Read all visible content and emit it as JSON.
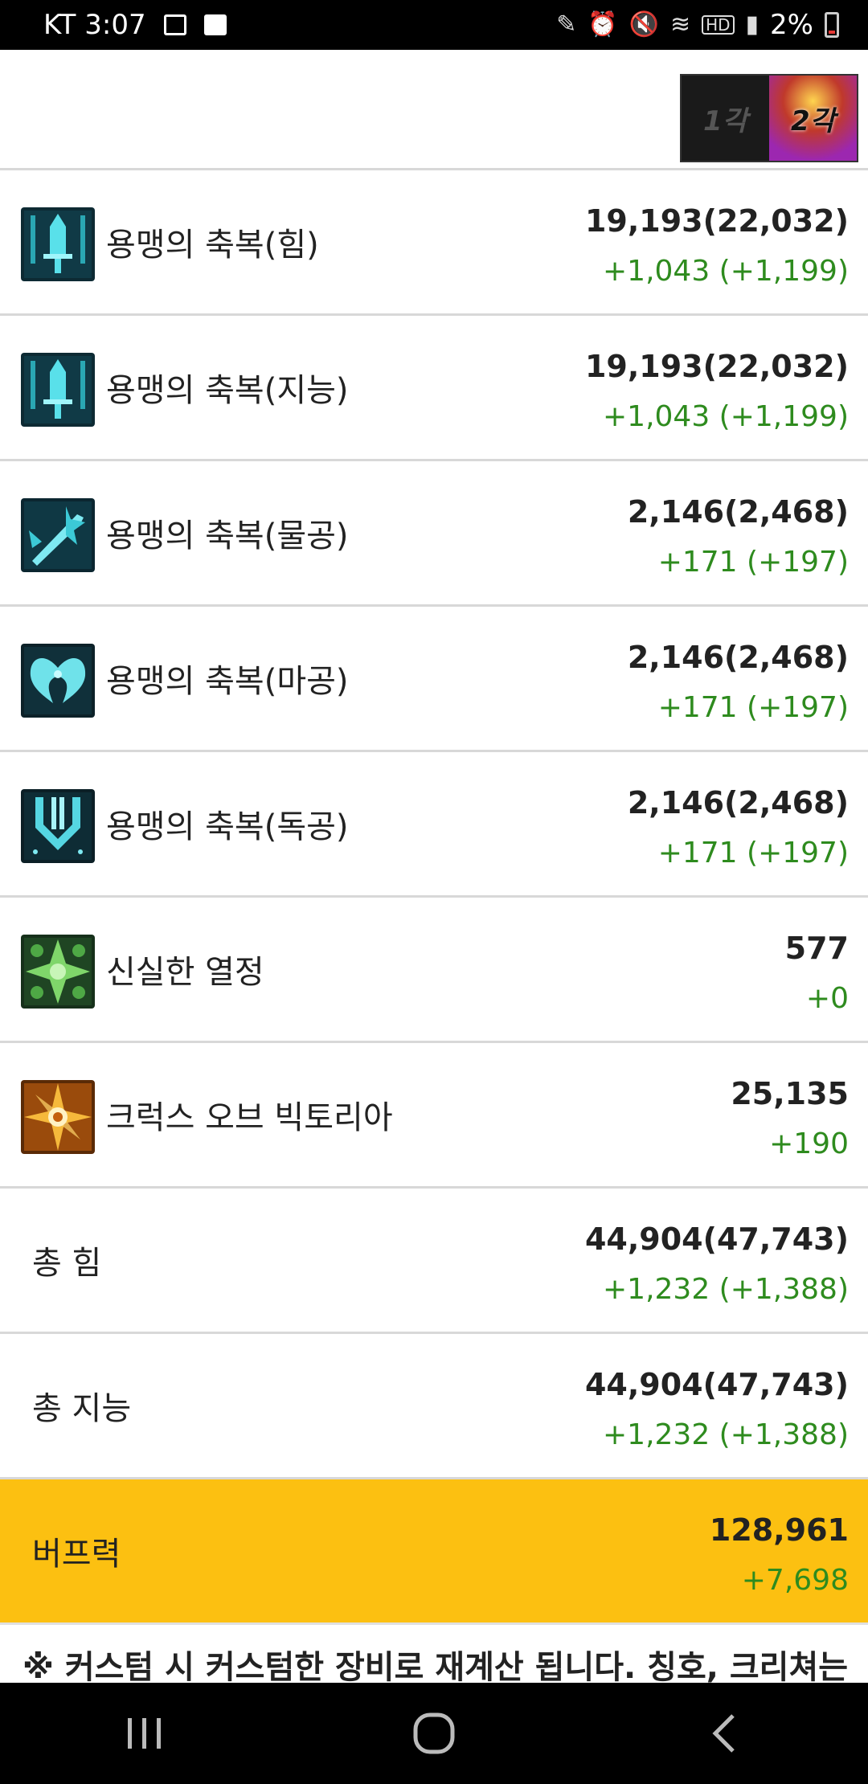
{
  "status_bar": {
    "carrier_time": "KT 3:07",
    "battery": "2%",
    "icons": [
      "image-icon",
      "checkbox-icon",
      "pen-icon",
      "alarm-icon",
      "mute-icon",
      "wifi-icon",
      "hd-icon",
      "signal-icon",
      "battery-icon"
    ]
  },
  "header": {
    "awaken_options": [
      "1각",
      "2각"
    ],
    "selected": "2각"
  },
  "rows": [
    {
      "icon": "sword-blessing-icon",
      "label": "용맹의 축복(힘)",
      "main": "19,193(22,032)",
      "sub": "+1,043 (+1,199)"
    },
    {
      "icon": "sword-blessing-icon",
      "label": "용맹의 축복(지능)",
      "main": "19,193(22,032)",
      "sub": "+1,043 (+1,199)"
    },
    {
      "icon": "crossed-sword-icon",
      "label": "용맹의 축복(물공)",
      "main": "2,146(2,468)",
      "sub": "+171 (+197)"
    },
    {
      "icon": "wings-icon",
      "label": "용맹의 축복(마공)",
      "main": "2,146(2,468)",
      "sub": "+171 (+197)"
    },
    {
      "icon": "shield-sparkle-icon",
      "label": "용맹의 축복(독공)",
      "main": "2,146(2,468)",
      "sub": "+171 (+197)"
    },
    {
      "icon": "green-cross-icon",
      "label": "신실한 열정",
      "main": "577",
      "sub": "+0"
    },
    {
      "icon": "golden-cross-icon",
      "label": "크럭스 오브 빅토리아",
      "main": "25,135",
      "sub": "+190"
    }
  ],
  "totals": [
    {
      "label": "총 힘",
      "main": "44,904(47,743)",
      "sub": "+1,232 (+1,388)"
    },
    {
      "label": "총 지능",
      "main": "44,904(47,743)",
      "sub": "+1,232 (+1,388)"
    }
  ],
  "buff_power": {
    "label": "버프력",
    "main": "128,961",
    "sub": "+7,698"
  },
  "note": "※ 커스텀 시 커스텀한 장비로 재계산 됩니다. 칭호, 크리쳐는",
  "colors": {
    "accent": "#fcc011",
    "positive": "#2e8b1e"
  },
  "nav": [
    "recent-apps-icon",
    "home-icon",
    "back-icon"
  ]
}
